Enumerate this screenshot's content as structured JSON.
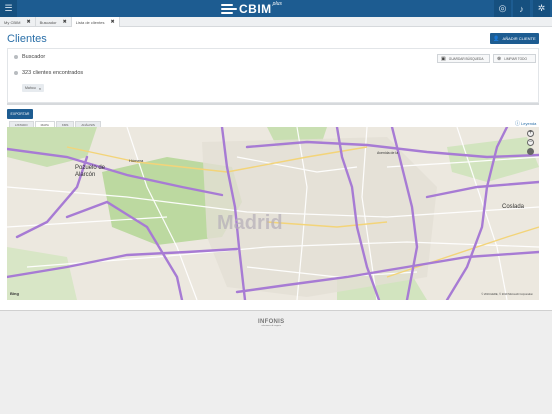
{
  "header": {
    "logo_text": "CBIM",
    "logo_sup": "plus",
    "icons": [
      "menu-icon",
      "globe-icon",
      "bell-icon",
      "gear-icon"
    ]
  },
  "tabs": [
    {
      "label": "My CBIM",
      "close": "✖"
    },
    {
      "label": "Buscador",
      "close": "✖"
    },
    {
      "label": "Lista de clientes",
      "close": "✖"
    }
  ],
  "page": {
    "title": "Clientes",
    "add_button": "AÑADIR CLIENTE"
  },
  "search_panel": {
    "finder_label": "Buscador",
    "results_label": "323 clientes encontrados",
    "filter_chip": "Mahou",
    "filter_chip_close": "×",
    "save_search": "GUARDAR BÚSQUEDA",
    "clear_all": "LIMPIAR TODO"
  },
  "map_section": {
    "export_button": "EXPORTAR",
    "tabs": [
      "LISTADO",
      "MAPA",
      "KMS",
      "ANÁLISIS"
    ],
    "active_tab": "MAPA",
    "legend_label": "Leyenda",
    "labels": {
      "city": "Madrid",
      "pozuelo": "Pozuelo de Alarcón",
      "coslada": "Coslada",
      "humera": "Húmera",
      "alcobendas": "Avenida de la"
    },
    "attribution": "Bing",
    "copyright": "© 2019 HERE, © 2019 Microsoft Corporation"
  },
  "footer": {
    "brand": "INFONIS",
    "tagline": "soluciones de negocio"
  },
  "colors": {
    "primary": "#1d5c91",
    "title": "#2a6fa8",
    "highway": "#a77bd4",
    "park": "#b9d89d"
  }
}
